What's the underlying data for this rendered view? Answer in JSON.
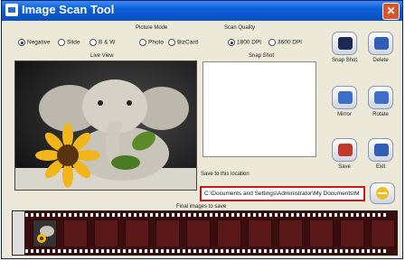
{
  "window": {
    "title": "Image Scan Tool",
    "close_symbol": "✕"
  },
  "film_type": {
    "options": [
      "Negative",
      "Slide",
      "B & W"
    ],
    "selected": "Negative"
  },
  "picture_mode": {
    "label": "Picture Mode",
    "options": [
      "Photo",
      "BizCard"
    ]
  },
  "scan_quality": {
    "label": "Scan Quality",
    "options": [
      "1800 DPI",
      "3600 DPI"
    ],
    "selected": "1800 DPI"
  },
  "live_view": {
    "label": "Live View"
  },
  "snap_shot": {
    "label": "Snap Shot"
  },
  "buttons": {
    "snap_shot": "Snap Shot",
    "delete": "Delete",
    "mirror": "Mirror",
    "rotate": "Rotate",
    "save": "Save",
    "exit": "Exit"
  },
  "save_location": {
    "label": "Save to this location",
    "path": "C:\\Documents and Settings\\Administrator\\My Documents\\M"
  },
  "filmstrip": {
    "label": "Final images to save"
  },
  "colors": {
    "title_bar": "#0b5fd8",
    "highlight_border": "#d01818",
    "film": "#3a0e0e"
  }
}
